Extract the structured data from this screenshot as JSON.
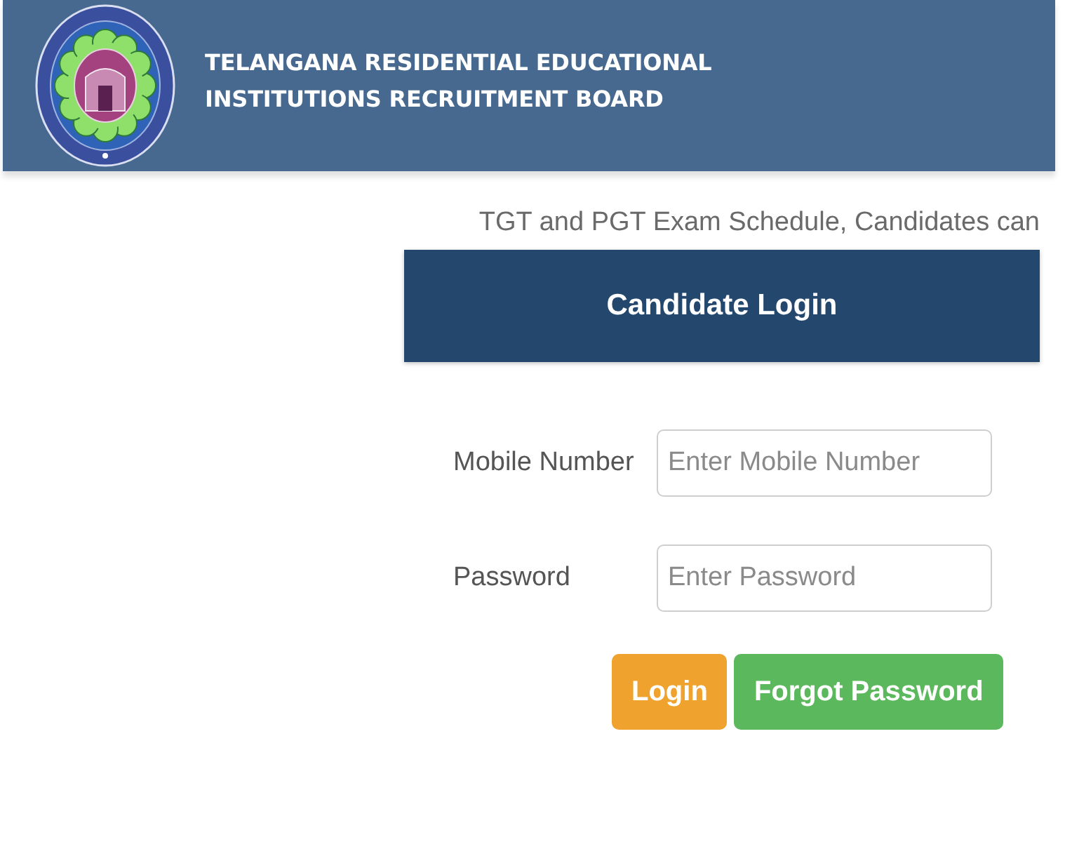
{
  "header": {
    "title_lines": [
      "TELANGANA RESIDENTIAL EDUCATIONAL",
      "INSTITUTIONS RECRUITMENT BOARD"
    ]
  },
  "ticker": {
    "text": "TGT and PGT Exam Schedule, Candidates can"
  },
  "login_panel": {
    "title": "Candidate Login"
  },
  "fields": [
    {
      "label": "Mobile Number",
      "placeholder": "Enter Mobile Number"
    },
    {
      "label": "Password",
      "placeholder": "Enter Password"
    }
  ],
  "buttons": [
    {
      "label": "Login",
      "kind": "warning"
    },
    {
      "label": "Forgot Password",
      "kind": "success"
    }
  ]
}
